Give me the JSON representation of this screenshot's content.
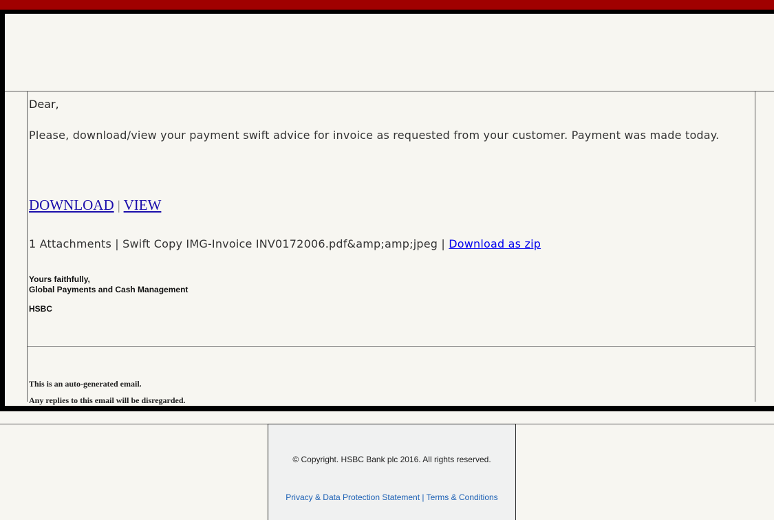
{
  "email": {
    "greeting": "Dear,",
    "message": "Please, download/view your payment swift advice for invoice as requested from your customer. Payment was made today.",
    "download_link": "DOWNLOAD",
    "separator": "|",
    "view_link": "VIEW",
    "attachments_text": "1 Attachments | Swift Copy IMG-Invoice INV0172006.pdf&amp;amp;jpeg | ",
    "download_zip_link": "Download as zip",
    "closing": "Yours faithfully,",
    "department": "Global Payments and Cash Management",
    "bank": "HSBC",
    "auto_notice_1": "This is an auto-generated email.",
    "auto_notice_2": "Any replies to this email will be disregarded."
  },
  "footer": {
    "copyright": "© Copyright. HSBC Bank plc 2016. All rights reserved.",
    "privacy_link": "Privacy & Data Protection Statement",
    "separator": " | ",
    "terms_link": "Terms & Conditions"
  },
  "colors": {
    "top_bar": "#a00000",
    "frame_border": "#000000",
    "background": "#f7f6f1",
    "link_blue": "#1a0dab"
  }
}
